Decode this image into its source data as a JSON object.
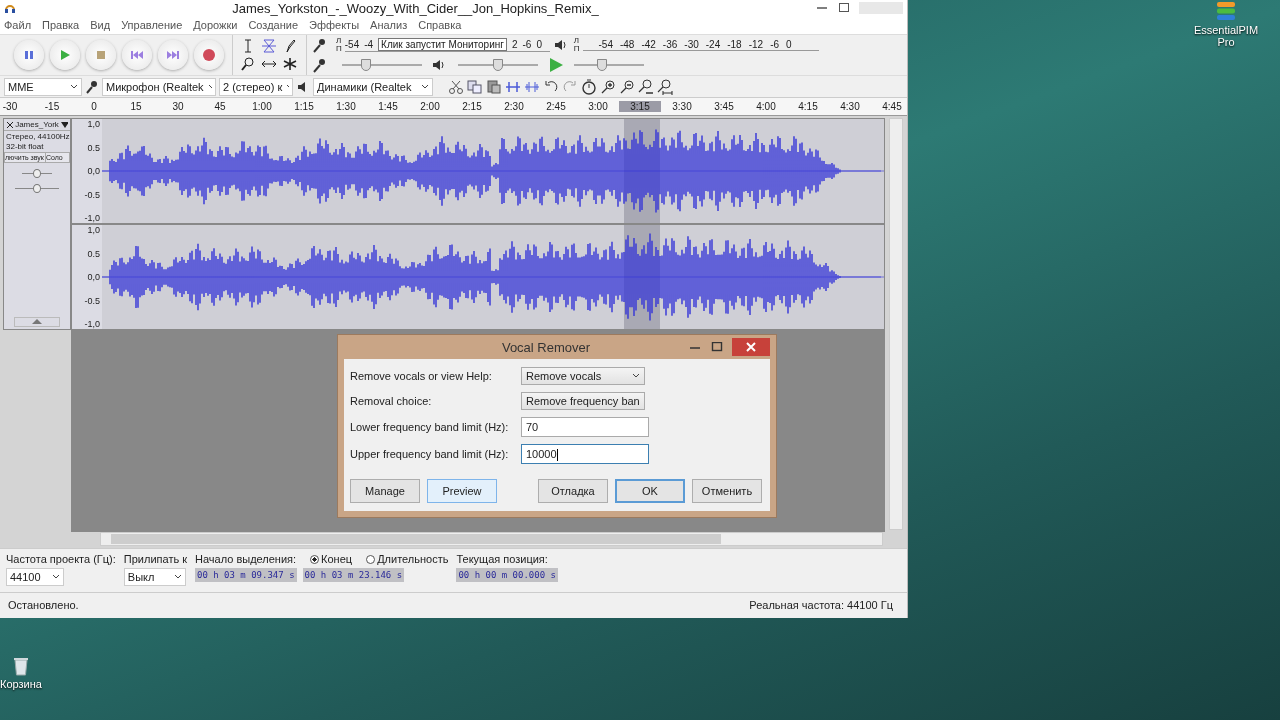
{
  "window": {
    "title": "James_Yorkston_-_Woozy_With_Cider__Jon_Hopkins_Remix_"
  },
  "menu": [
    "Файл",
    "Правка",
    "Вид",
    "Управление",
    "Дорожки",
    "Создание",
    "Эффекты",
    "Анализ",
    "Справка"
  ],
  "record_meter": {
    "labels_start": [
      "-54",
      "-4"
    ],
    "tooltip": "Клик запустит Мониторинг",
    "labels_end": [
      "2",
      "-6",
      "0"
    ],
    "channel_labels": [
      "Л",
      "П"
    ]
  },
  "play_meter": {
    "labels": [
      "-54",
      "-48",
      "-42",
      "-36",
      "-30",
      "-24",
      "-18",
      "-12",
      "-6",
      "0"
    ],
    "channel_labels": [
      "Л",
      "П"
    ]
  },
  "sliders": {
    "record_volume": {
      "level": 0.3
    },
    "play_volume": {
      "level": 0.5
    },
    "play_speed": {
      "level": 0.4
    }
  },
  "device_bar": {
    "host": "MME",
    "mic": "Микрофон (Realtek",
    "channels": "2 (стерео) к",
    "speaker": "Динамики (Realtek"
  },
  "ruler": [
    {
      "label": "-30",
      "selected": false
    },
    {
      "label": "-15",
      "selected": false
    },
    {
      "label": "0",
      "selected": false
    },
    {
      "label": "15",
      "selected": false
    },
    {
      "label": "30",
      "selected": false
    },
    {
      "label": "45",
      "selected": false
    },
    {
      "label": "1:00",
      "selected": false
    },
    {
      "label": "1:15",
      "selected": false
    },
    {
      "label": "1:30",
      "selected": false
    },
    {
      "label": "1:45",
      "selected": false
    },
    {
      "label": "2:00",
      "selected": false
    },
    {
      "label": "2:15",
      "selected": false
    },
    {
      "label": "2:30",
      "selected": false
    },
    {
      "label": "2:45",
      "selected": false
    },
    {
      "label": "3:00",
      "selected": false
    },
    {
      "label": "3:15",
      "selected": true
    },
    {
      "label": "3:30",
      "selected": false
    },
    {
      "label": "3:45",
      "selected": false
    },
    {
      "label": "4:00",
      "selected": false
    },
    {
      "label": "4:15",
      "selected": false
    },
    {
      "label": "4:30",
      "selected": false
    },
    {
      "label": "4:45",
      "selected": false
    }
  ],
  "track": {
    "name": "James_York",
    "info": [
      "Стерео, 44100Hz",
      "32-bit float"
    ],
    "mute": "лючить звук",
    "solo": "Соло",
    "gain": {
      "level": 0.5
    },
    "pan": {
      "level": 0.5
    },
    "channels": [
      {
        "scale": [
          "1,0",
          "0.5",
          "0,0",
          "-0.5",
          "-1,0"
        ]
      },
      {
        "scale": [
          "1,0",
          "0.5",
          "0,0",
          "-0.5",
          "-1,0"
        ]
      }
    ]
  },
  "dialog": {
    "title": "Vocal Remover",
    "rows": [
      {
        "kind": "select",
        "label": "Remove vocals or view Help:",
        "value": "Remove vocals"
      },
      {
        "kind": "select",
        "label": "Removal choice:",
        "value": "Remove frequency ban"
      },
      {
        "kind": "input",
        "label": "Lower frequency band limit (Hz):",
        "value": "70",
        "focused": false
      },
      {
        "kind": "input",
        "label": "Upper frequency band limit (Hz):",
        "value": "10000",
        "focused": true
      }
    ],
    "buttons": [
      {
        "label": "Manage",
        "hovered": false,
        "default": false
      },
      {
        "label": "Preview",
        "hovered": true,
        "default": false
      },
      {
        "label": "Отладка",
        "hovered": false,
        "default": false
      },
      {
        "label": "OK",
        "hovered": false,
        "default": true
      },
      {
        "label": "Отменить",
        "hovered": false,
        "default": false
      }
    ]
  },
  "selection_bar": {
    "rate_label": "Частота проекта (Гц):",
    "rate": "44100",
    "snap_label": "Прилипать к",
    "snap": "Выкл",
    "start_label": "Начало выделения:",
    "radios": [
      {
        "label": "Конец",
        "selected": true
      },
      {
        "label": "Длительность",
        "selected": false
      }
    ],
    "start": "00 h 03 m 09.347 s",
    "end": "00 h 03 m 23.146 s",
    "position_label": "Текущая позиция:",
    "position": "00 h 00 m 00.000 s"
  },
  "status_bar": {
    "state": "Остановлено.",
    "rate": "Реальная частота: 44100 Гц"
  },
  "desktop_icons": [
    {
      "kind": "pim",
      "label": "EssentialPIM Pro"
    },
    {
      "kind": "bin",
      "label": "Корзина"
    }
  ]
}
